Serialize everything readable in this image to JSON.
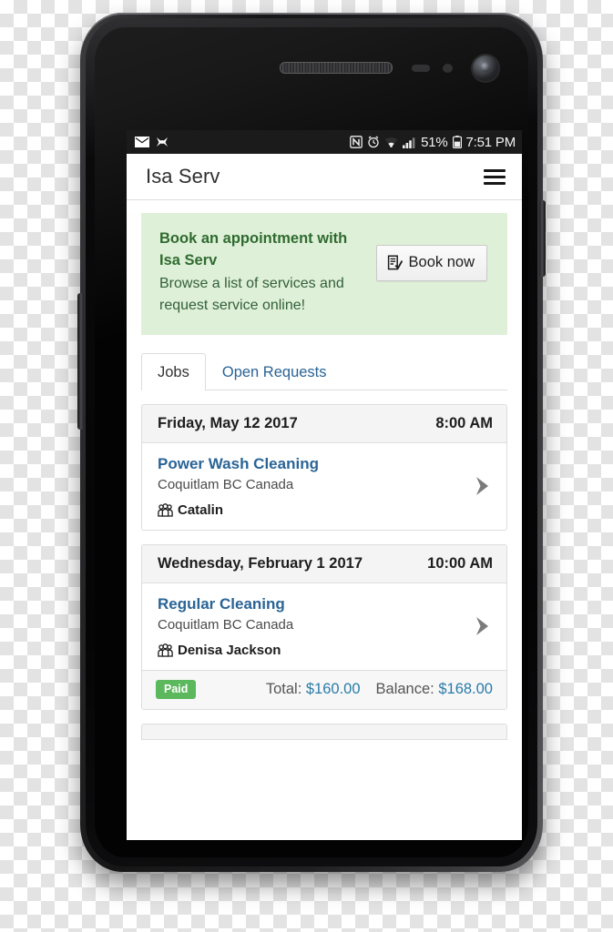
{
  "status_bar": {
    "left_icons": [
      "mail-icon",
      "app-icon"
    ],
    "right_icons": [
      "nfc-icon",
      "alarm-icon",
      "wifi-icon",
      "signal-icon"
    ],
    "battery_percent": "51%",
    "time": "7:51 PM"
  },
  "app_bar": {
    "title": "Isa Serv",
    "menu_icon": "hamburger-icon"
  },
  "promo": {
    "title": "Book an appointment with Isa Serv",
    "subtitle": "Browse a list of services and request service online!",
    "button_label": "Book now",
    "button_icon": "form-check-icon",
    "background_color": "#dff0d8",
    "title_color": "#2f6b30"
  },
  "tabs": [
    {
      "label": "Jobs",
      "active": true
    },
    {
      "label": "Open Requests",
      "active": false
    }
  ],
  "jobs": [
    {
      "date": "Friday, May 12 2017",
      "time": "8:00 AM",
      "title": "Power Wash Cleaning",
      "location": "Coquitlam BC Canada",
      "person": "Catalin",
      "person_icon": "people-group-icon",
      "chevron_icon": "chevron-right-icon",
      "has_footer": false
    },
    {
      "date": "Wednesday, February 1 2017",
      "time": "10:00 AM",
      "title": "Regular Cleaning",
      "location": "Coquitlam BC Canada",
      "person": "Denisa Jackson",
      "person_icon": "people-group-icon",
      "chevron_icon": "chevron-right-icon",
      "has_footer": true,
      "footer": {
        "badge": "Paid",
        "badge_color": "#5cb85c",
        "total_label": "Total:",
        "total_value": "$160.00",
        "balance_label": "Balance:",
        "balance_value": "$168.00",
        "value_color": "#2a7ba8"
      }
    }
  ],
  "theme": {
    "link_color": "#2a6496",
    "card_border": "#dddddd",
    "card_header_bg": "#f4f4f4"
  }
}
